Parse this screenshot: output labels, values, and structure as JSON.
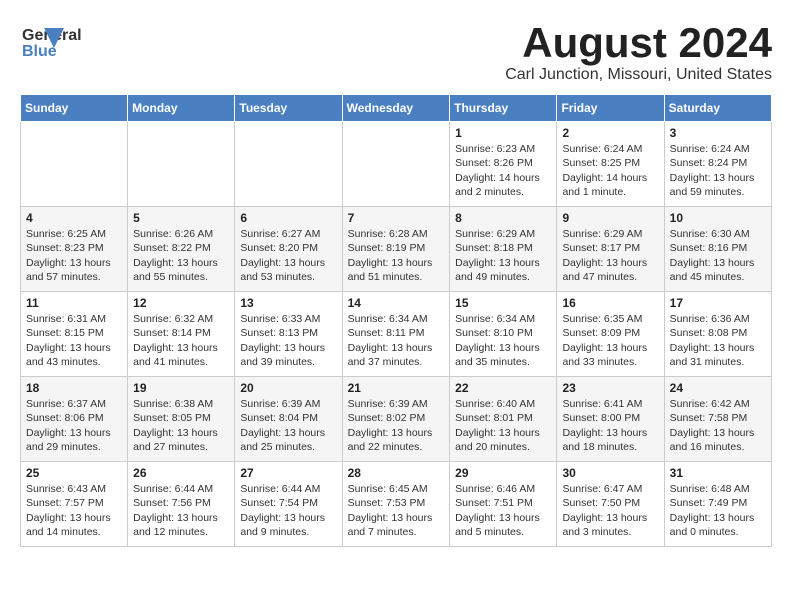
{
  "header": {
    "logo_line1": "General",
    "logo_line2": "Blue",
    "month": "August 2024",
    "location": "Carl Junction, Missouri, United States"
  },
  "weekdays": [
    "Sunday",
    "Monday",
    "Tuesday",
    "Wednesday",
    "Thursday",
    "Friday",
    "Saturday"
  ],
  "weeks": [
    [
      {
        "day": "",
        "info": ""
      },
      {
        "day": "",
        "info": ""
      },
      {
        "day": "",
        "info": ""
      },
      {
        "day": "",
        "info": ""
      },
      {
        "day": "1",
        "info": "Sunrise: 6:23 AM\nSunset: 8:26 PM\nDaylight: 14 hours\nand 2 minutes."
      },
      {
        "day": "2",
        "info": "Sunrise: 6:24 AM\nSunset: 8:25 PM\nDaylight: 14 hours\nand 1 minute."
      },
      {
        "day": "3",
        "info": "Sunrise: 6:24 AM\nSunset: 8:24 PM\nDaylight: 13 hours\nand 59 minutes."
      }
    ],
    [
      {
        "day": "4",
        "info": "Sunrise: 6:25 AM\nSunset: 8:23 PM\nDaylight: 13 hours\nand 57 minutes."
      },
      {
        "day": "5",
        "info": "Sunrise: 6:26 AM\nSunset: 8:22 PM\nDaylight: 13 hours\nand 55 minutes."
      },
      {
        "day": "6",
        "info": "Sunrise: 6:27 AM\nSunset: 8:20 PM\nDaylight: 13 hours\nand 53 minutes."
      },
      {
        "day": "7",
        "info": "Sunrise: 6:28 AM\nSunset: 8:19 PM\nDaylight: 13 hours\nand 51 minutes."
      },
      {
        "day": "8",
        "info": "Sunrise: 6:29 AM\nSunset: 8:18 PM\nDaylight: 13 hours\nand 49 minutes."
      },
      {
        "day": "9",
        "info": "Sunrise: 6:29 AM\nSunset: 8:17 PM\nDaylight: 13 hours\nand 47 minutes."
      },
      {
        "day": "10",
        "info": "Sunrise: 6:30 AM\nSunset: 8:16 PM\nDaylight: 13 hours\nand 45 minutes."
      }
    ],
    [
      {
        "day": "11",
        "info": "Sunrise: 6:31 AM\nSunset: 8:15 PM\nDaylight: 13 hours\nand 43 minutes."
      },
      {
        "day": "12",
        "info": "Sunrise: 6:32 AM\nSunset: 8:14 PM\nDaylight: 13 hours\nand 41 minutes."
      },
      {
        "day": "13",
        "info": "Sunrise: 6:33 AM\nSunset: 8:13 PM\nDaylight: 13 hours\nand 39 minutes."
      },
      {
        "day": "14",
        "info": "Sunrise: 6:34 AM\nSunset: 8:11 PM\nDaylight: 13 hours\nand 37 minutes."
      },
      {
        "day": "15",
        "info": "Sunrise: 6:34 AM\nSunset: 8:10 PM\nDaylight: 13 hours\nand 35 minutes."
      },
      {
        "day": "16",
        "info": "Sunrise: 6:35 AM\nSunset: 8:09 PM\nDaylight: 13 hours\nand 33 minutes."
      },
      {
        "day": "17",
        "info": "Sunrise: 6:36 AM\nSunset: 8:08 PM\nDaylight: 13 hours\nand 31 minutes."
      }
    ],
    [
      {
        "day": "18",
        "info": "Sunrise: 6:37 AM\nSunset: 8:06 PM\nDaylight: 13 hours\nand 29 minutes."
      },
      {
        "day": "19",
        "info": "Sunrise: 6:38 AM\nSunset: 8:05 PM\nDaylight: 13 hours\nand 27 minutes."
      },
      {
        "day": "20",
        "info": "Sunrise: 6:39 AM\nSunset: 8:04 PM\nDaylight: 13 hours\nand 25 minutes."
      },
      {
        "day": "21",
        "info": "Sunrise: 6:39 AM\nSunset: 8:02 PM\nDaylight: 13 hours\nand 22 minutes."
      },
      {
        "day": "22",
        "info": "Sunrise: 6:40 AM\nSunset: 8:01 PM\nDaylight: 13 hours\nand 20 minutes."
      },
      {
        "day": "23",
        "info": "Sunrise: 6:41 AM\nSunset: 8:00 PM\nDaylight: 13 hours\nand 18 minutes."
      },
      {
        "day": "24",
        "info": "Sunrise: 6:42 AM\nSunset: 7:58 PM\nDaylight: 13 hours\nand 16 minutes."
      }
    ],
    [
      {
        "day": "25",
        "info": "Sunrise: 6:43 AM\nSunset: 7:57 PM\nDaylight: 13 hours\nand 14 minutes."
      },
      {
        "day": "26",
        "info": "Sunrise: 6:44 AM\nSunset: 7:56 PM\nDaylight: 13 hours\nand 12 minutes."
      },
      {
        "day": "27",
        "info": "Sunrise: 6:44 AM\nSunset: 7:54 PM\nDaylight: 13 hours\nand 9 minutes."
      },
      {
        "day": "28",
        "info": "Sunrise: 6:45 AM\nSunset: 7:53 PM\nDaylight: 13 hours\nand 7 minutes."
      },
      {
        "day": "29",
        "info": "Sunrise: 6:46 AM\nSunset: 7:51 PM\nDaylight: 13 hours\nand 5 minutes."
      },
      {
        "day": "30",
        "info": "Sunrise: 6:47 AM\nSunset: 7:50 PM\nDaylight: 13 hours\nand 3 minutes."
      },
      {
        "day": "31",
        "info": "Sunrise: 6:48 AM\nSunset: 7:49 PM\nDaylight: 13 hours\nand 0 minutes."
      }
    ]
  ]
}
